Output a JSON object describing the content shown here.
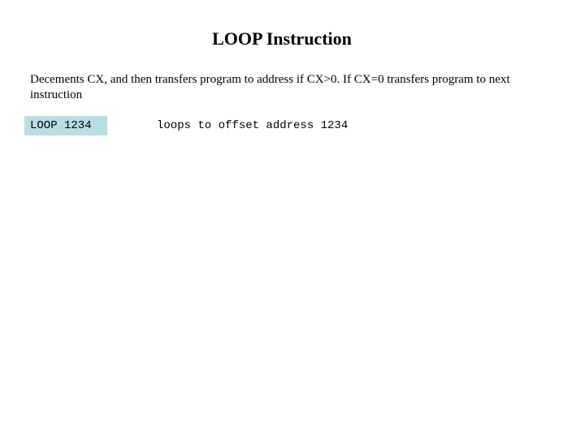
{
  "slide": {
    "title": "LOOP Instruction",
    "description": "Decements CX, and then transfers program to address if CX>0.  If CX=0 transfers program to next instruction",
    "example": {
      "code": "LOOP 1234",
      "explanation": "loops to offset address 1234",
      "highlight_color": "#b9dde3"
    }
  }
}
